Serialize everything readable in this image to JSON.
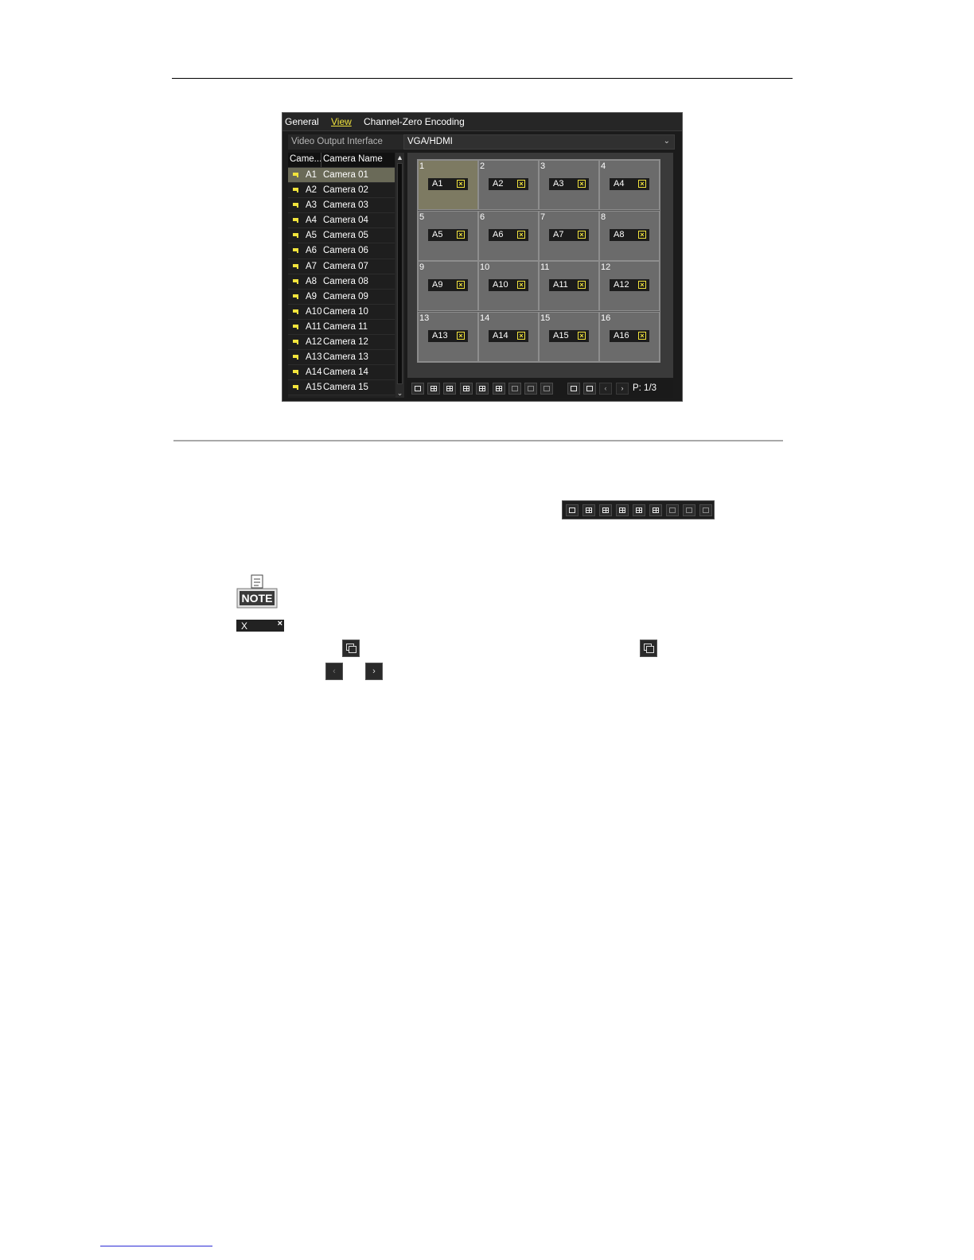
{
  "dvr": {
    "tabs": [
      "General",
      "View",
      "Channel-Zero Encoding"
    ],
    "active_tab": "View",
    "video_output": {
      "label": "Video Output Interface",
      "value": "VGA/HDMI"
    },
    "list_headers": {
      "camera": "Came...",
      "camera_name": "Camera Name"
    },
    "cameras": [
      {
        "id": "A1",
        "name": "Camera 01"
      },
      {
        "id": "A2",
        "name": "Camera 02"
      },
      {
        "id": "A3",
        "name": "Camera 03"
      },
      {
        "id": "A4",
        "name": "Camera 04"
      },
      {
        "id": "A5",
        "name": "Camera 05"
      },
      {
        "id": "A6",
        "name": "Camera 06"
      },
      {
        "id": "A7",
        "name": "Camera 07"
      },
      {
        "id": "A8",
        "name": "Camera 08"
      },
      {
        "id": "A9",
        "name": "Camera 09"
      },
      {
        "id": "A10",
        "name": "Camera 10"
      },
      {
        "id": "A11",
        "name": "Camera 11"
      },
      {
        "id": "A12",
        "name": "Camera 12"
      },
      {
        "id": "A13",
        "name": "Camera 13"
      },
      {
        "id": "A14",
        "name": "Camera 14"
      },
      {
        "id": "A15",
        "name": "Camera 15"
      }
    ],
    "selected_camera": "A1",
    "grid": [
      {
        "num": "1",
        "cam": "A1"
      },
      {
        "num": "2",
        "cam": "A2"
      },
      {
        "num": "3",
        "cam": "A3"
      },
      {
        "num": "4",
        "cam": "A4"
      },
      {
        "num": "5",
        "cam": "A5"
      },
      {
        "num": "6",
        "cam": "A6"
      },
      {
        "num": "7",
        "cam": "A7"
      },
      {
        "num": "8",
        "cam": "A8"
      },
      {
        "num": "9",
        "cam": "A9"
      },
      {
        "num": "10",
        "cam": "A10"
      },
      {
        "num": "11",
        "cam": "A11"
      },
      {
        "num": "12",
        "cam": "A12"
      },
      {
        "num": "13",
        "cam": "A13"
      },
      {
        "num": "14",
        "cam": "A14"
      },
      {
        "num": "15",
        "cam": "A15"
      },
      {
        "num": "16",
        "cam": "A16"
      }
    ],
    "page_indicator": "P: 1/3",
    "accent_color": "#f1e33c"
  },
  "icons": {
    "layout_buttons": [
      "layout-1-icon",
      "layout-4-icon",
      "layout-6-icon",
      "layout-8-icon",
      "layout-9-icon",
      "layout-16-icon",
      "layout-25-icon",
      "layout-32-icon",
      "layout-36-icon"
    ],
    "note_label": "NOTE",
    "xbar_label": "X"
  }
}
